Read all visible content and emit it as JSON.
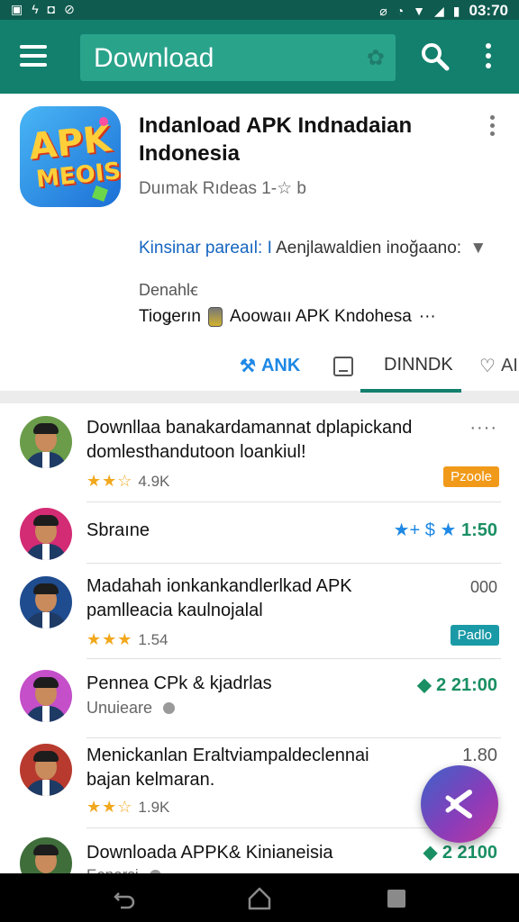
{
  "status_bar": {
    "time": "03:70",
    "left_icons": [
      "sim-icon",
      "bolt-icon",
      "lock-icon",
      "check-circle-icon"
    ],
    "right_icons": [
      "vibrate-icon",
      "clock-icon",
      "wifi-icon",
      "signal-icon",
      "battery-icon"
    ]
  },
  "toolbar": {
    "search_text": "Download",
    "icons": [
      "menu-icon",
      "search-icon",
      "more-vert-icon"
    ]
  },
  "app": {
    "title": "Indanload APK Indnadaian Indonesia",
    "subtitle": "Duımak Rıdeas 1-☆ b",
    "link_label": "Kinsinar pareaıl: I",
    "link_text": "Aenjlawaldien inoğaano:",
    "dev_label": "Denahlꞓ",
    "line_prefix": "Tioǥerın",
    "line_text": "Aoowaıı APK Kndohesa",
    "line_ellipsis": "···"
  },
  "tabs": [
    {
      "label": "ANK",
      "icon": "tools-icon"
    },
    {
      "label": "",
      "icon": "document-icon"
    },
    {
      "label": "DINNDK",
      "icon": ""
    },
    {
      "label": "AI",
      "icon": "heart-icon"
    }
  ],
  "list": [
    {
      "title": "Downllaa banakardamannat dplapickand domlesthandutoon loankiul!",
      "rating": "4.9K",
      "stars": 2.5,
      "badge": "Pzoole",
      "badge_color": "#f19a1a",
      "meta": "····"
    },
    {
      "title": "Sbraıne",
      "meta": "1:50",
      "meta_prefix": "★+ $ ★"
    },
    {
      "title": "Madahah ionkankandlerlkad APK pamlleacia kaulnojalal",
      "rating": "1.54",
      "stars": 3,
      "badge": "Padlo",
      "badge_color": "#1a9aa6",
      "meta": "000"
    },
    {
      "title": "Pennea CPk & kjadrlas",
      "subtitle": "Unuieare",
      "meta": "2 21:00"
    },
    {
      "title": "Menickanlan Eraltviampaldeclennai bajan kelmaran.",
      "rating": "1.9K",
      "stars": 2.5,
      "meta": "1.80"
    },
    {
      "title": "Downloada APPK& Kinianeisia",
      "subtitle": "Eenarsi",
      "meta": "2 2100"
    }
  ],
  "fab": {
    "icon": "collapse-arrows-icon"
  },
  "nav_bar": {
    "icons": [
      "back-icon",
      "home-icon",
      "recents-icon"
    ]
  },
  "colors": {
    "toolbar": "#12806d",
    "status_bar": "#0f5b4f",
    "accent": "#1e88e5",
    "badge_orange": "#f19a1a",
    "badge_teal": "#1a9aa6",
    "star": "#f2a81d"
  }
}
